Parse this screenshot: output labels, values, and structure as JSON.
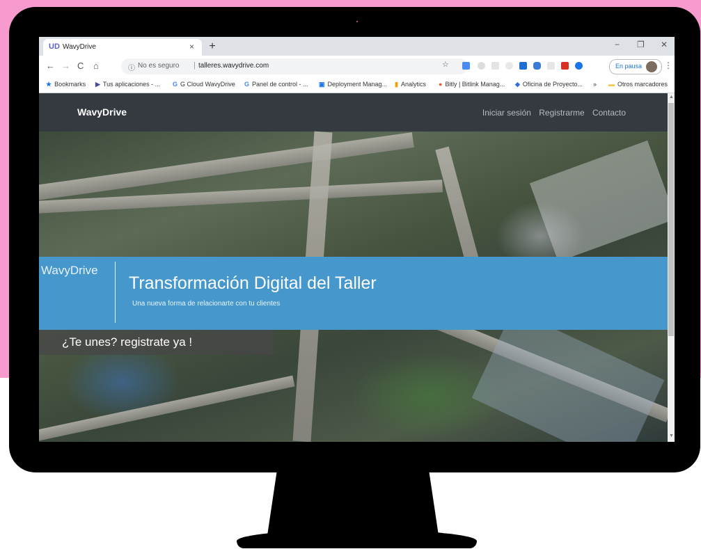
{
  "browser": {
    "tab_title": "WavyDrive",
    "tab_icon_glyph": "UD",
    "tab_close": "×",
    "new_tab": "+",
    "window_minimize": "−",
    "window_restore": "❐",
    "window_close": "✕",
    "security_text": "No es seguro",
    "url": "talleres.wavydrive.com",
    "profile_label": "En pausa",
    "bookmarks": [
      {
        "label": "Bookmarks",
        "icon": "★",
        "icon_color": "#1a73e8"
      },
      {
        "label": "Tus aplicaciones - ...",
        "icon": "▶",
        "icon_color": "#4a4a9a"
      },
      {
        "label": "G Cloud WavyDrive",
        "icon": "G",
        "icon_color": "#4285f4"
      },
      {
        "label": "Panel de control - ...",
        "icon": "G",
        "icon_color": "#4285f4"
      },
      {
        "label": "Deployment Manag...",
        "icon": "▣",
        "icon_color": "#1a73e8"
      },
      {
        "label": "Analytics",
        "icon": "▮",
        "icon_color": "#f4a000"
      },
      {
        "label": "Bitly | Bitlink Manag...",
        "icon": "●",
        "icon_color": "#ee6123"
      },
      {
        "label": "Oficina de Proyecto...",
        "icon": "◆",
        "icon_color": "#2f6fdb"
      },
      {
        "label": "»",
        "icon": "",
        "icon_color": "#555"
      },
      {
        "label": "Otros marcadores",
        "icon": "▬",
        "icon_color": "#f2c94c"
      }
    ]
  },
  "site": {
    "brand": "WavyDrive",
    "nav": [
      "Iniciar sesión",
      "Registrarme",
      "Contacto"
    ],
    "banner_brand": "WavyDrive",
    "banner_title": "Transformación Digital del Taller",
    "banner_subtitle": "Una nueva forma de relacionarte con tu clientes",
    "cta": "¿Te unes? registrate ya !"
  },
  "colors": {
    "navbar": "#343a40",
    "banner": "#4698cc",
    "background_pink": "#f79bcf"
  }
}
